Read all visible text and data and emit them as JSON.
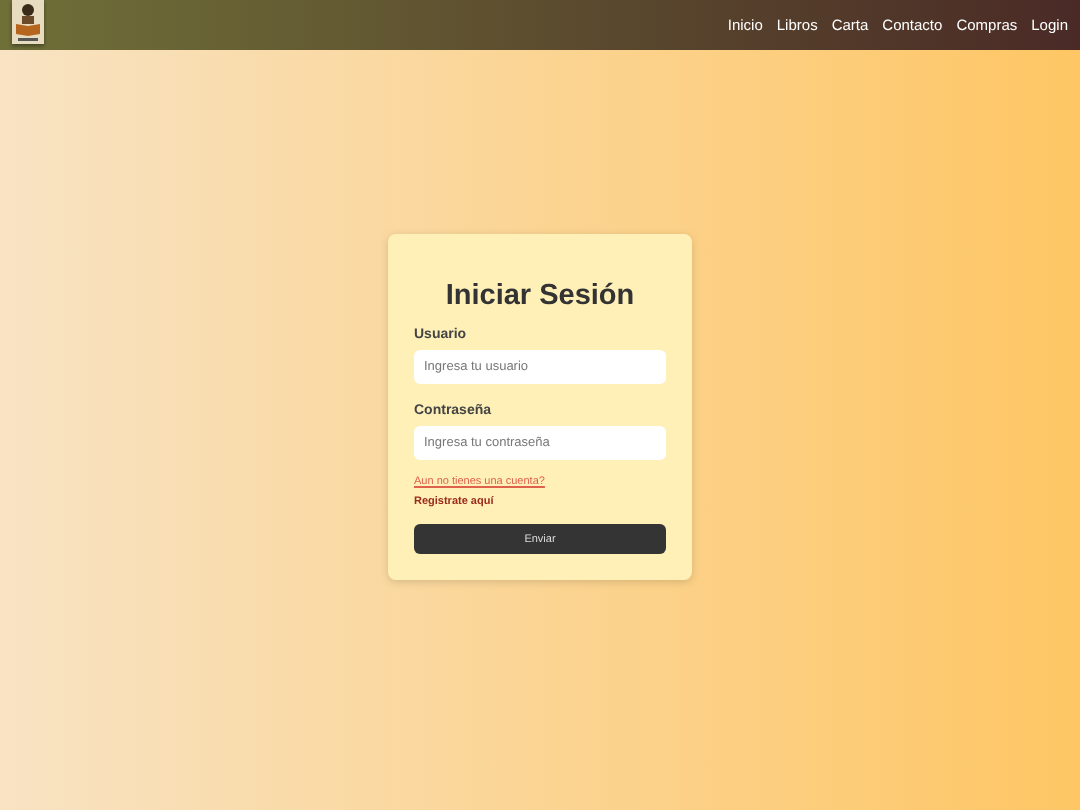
{
  "nav": {
    "links": [
      "Inicio",
      "Libros",
      "Carta",
      "Contacto",
      "Compras",
      "Login"
    ]
  },
  "login": {
    "title": "Iniciar Sesión",
    "fields": [
      {
        "label": "Usuario",
        "placeholder": "Ingresa tu usuario"
      },
      {
        "label": "Contraseña",
        "placeholder": "Ingresa tu contraseña"
      }
    ],
    "question_link": "Aun no tienes una cuenta?",
    "register_link": "Registrate aquí",
    "submit": "Enviar"
  }
}
